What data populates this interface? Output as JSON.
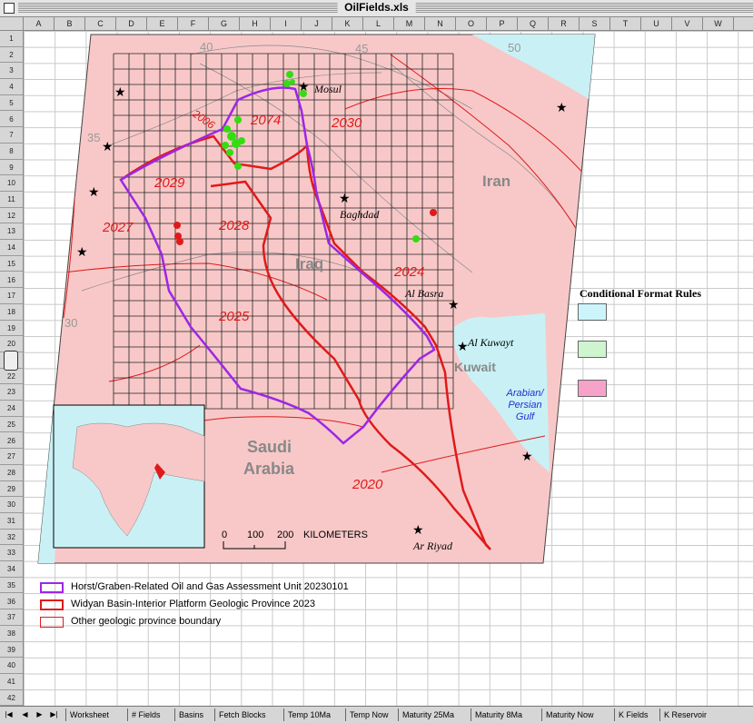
{
  "window": {
    "title": "OilFields.xls"
  },
  "columns": [
    "A",
    "B",
    "C",
    "D",
    "E",
    "F",
    "G",
    "H",
    "I",
    "J",
    "K",
    "L",
    "M",
    "N",
    "O",
    "P",
    "Q",
    "R",
    "S",
    "T",
    "U",
    "V",
    "W"
  ],
  "rows": [
    "1",
    "2",
    "3",
    "4",
    "5",
    "6",
    "7",
    "8",
    "9",
    "10",
    "11",
    "12",
    "13",
    "14",
    "15",
    "16",
    "17",
    "18",
    "19",
    "20",
    "21",
    "22",
    "23",
    "24",
    "25",
    "26",
    "27",
    "28",
    "29",
    "30",
    "31",
    "32",
    "33",
    "34",
    "35",
    "36",
    "37",
    "38",
    "39",
    "40",
    "41",
    "42"
  ],
  "map": {
    "countries": [
      "Iraq",
      "Iran",
      "Kuwait",
      "Saudi",
      "Arabia"
    ],
    "cities": [
      "Mosul",
      "Baghdad",
      "Al Basra",
      "Al Kuwayt",
      "Ar Riyad"
    ],
    "gulf": [
      "Arabian/",
      "Persian",
      "Gulf"
    ],
    "units": [
      "2074",
      "2030",
      "2029",
      "2027",
      "2028",
      "2024",
      "2025",
      "2020",
      "2006"
    ],
    "contours": [
      "40",
      "45",
      "50",
      "35",
      "30"
    ],
    "scale": {
      "ticks": [
        "0",
        "100",
        "200"
      ],
      "label": "KILOMETERS"
    }
  },
  "conditional_format": {
    "title": "Conditional Format Rules",
    "swatches": [
      "#ccf5fb",
      "#cff5cf",
      "#f7a2c8"
    ]
  },
  "legend": [
    {
      "label": "Horst/Graben-Related Oil and Gas Assessment Unit 20230101",
      "color": "#9c27e6"
    },
    {
      "label": "Widyan Basin-Interior Platform Geologic Province 2023",
      "color": "#e01a1a"
    },
    {
      "label": "Other geologic province boundary",
      "color": "#e01a1a"
    }
  ],
  "tabs": [
    "Worksheet",
    "# Fields",
    "Basins",
    "Fetch Blocks",
    "Temp 10Ma",
    "Temp Now",
    "Maturity 25Ma",
    "Maturity 8Ma",
    "Maturity Now",
    "K Fields",
    "K Reservoir"
  ],
  "colors": {
    "land": "#f8c8c8",
    "sea": "#c9f1f5",
    "field_green": "#33dd11",
    "province_red": "#e01a1a",
    "assessment_purple": "#9c27e6"
  }
}
